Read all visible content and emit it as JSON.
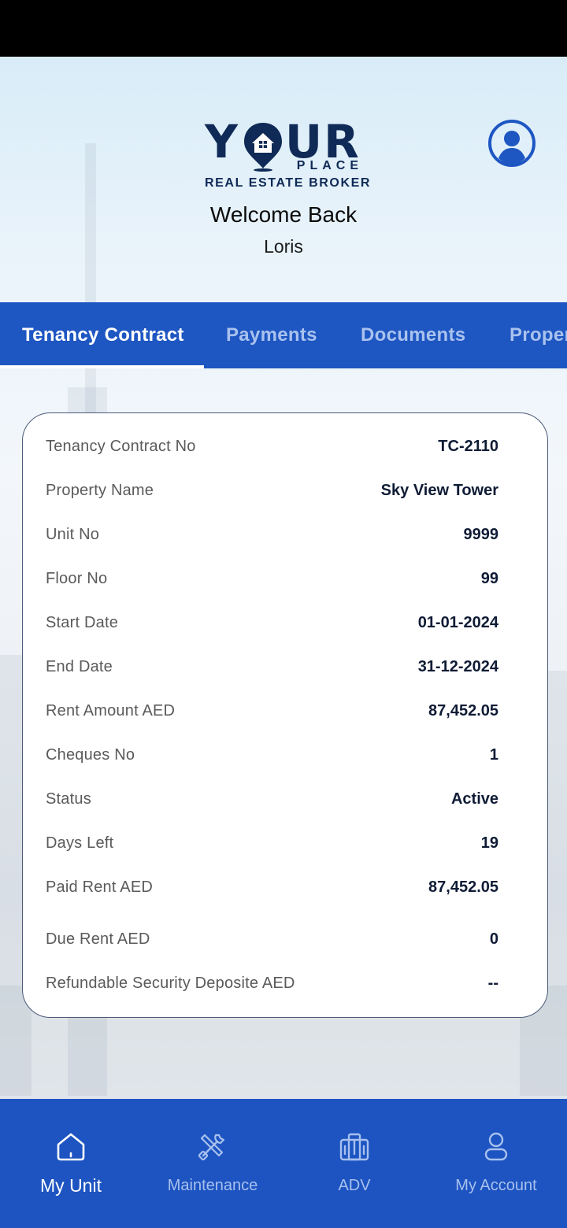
{
  "header": {
    "logo_main_y": "Y",
    "logo_main_ur": "UR",
    "logo_place": "PLACE",
    "logo_tagline": "REAL ESTATE BROKER",
    "welcome": "Welcome Back",
    "username": "Loris",
    "profile_icon": "user-circle-icon"
  },
  "tabs": [
    {
      "label": "Tenancy Contract",
      "active": true
    },
    {
      "label": "Payments",
      "active": false
    },
    {
      "label": "Documents",
      "active": false
    },
    {
      "label": "Proper",
      "active": false
    }
  ],
  "contract": {
    "rows": [
      {
        "label": "Tenancy Contract No",
        "value": "TC-2110"
      },
      {
        "label": "Property Name",
        "value": "Sky View Tower"
      },
      {
        "label": "Unit No",
        "value": "9999"
      },
      {
        "label": "Floor No",
        "value": "99"
      },
      {
        "label": "Start Date",
        "value": "01-01-2024"
      },
      {
        "label": "End Date",
        "value": "31-12-2024"
      },
      {
        "label": "Rent Amount AED",
        "value": "87,452.05"
      },
      {
        "label": "Cheques No",
        "value": "1"
      },
      {
        "label": "Status",
        "value": "Active"
      },
      {
        "label": "Days Left",
        "value": "19"
      },
      {
        "label": "Paid Rent AED",
        "value": "87,452.05"
      },
      {
        "label": "Due Rent AED",
        "value": "0"
      },
      {
        "label": "Refundable Security Deposite AED",
        "value": "--"
      }
    ]
  },
  "bottom_nav": [
    {
      "label": "My Unit",
      "icon": "home-icon",
      "active": true
    },
    {
      "label": "Maintenance",
      "icon": "tools-icon",
      "active": false
    },
    {
      "label": "ADV",
      "icon": "building-icon",
      "active": false
    },
    {
      "label": "My Account",
      "icon": "user-icon",
      "active": false
    }
  ],
  "colors": {
    "primary": "#1e56c2",
    "navy": "#0f2a56",
    "tab_inactive": "#a9c2ee"
  }
}
